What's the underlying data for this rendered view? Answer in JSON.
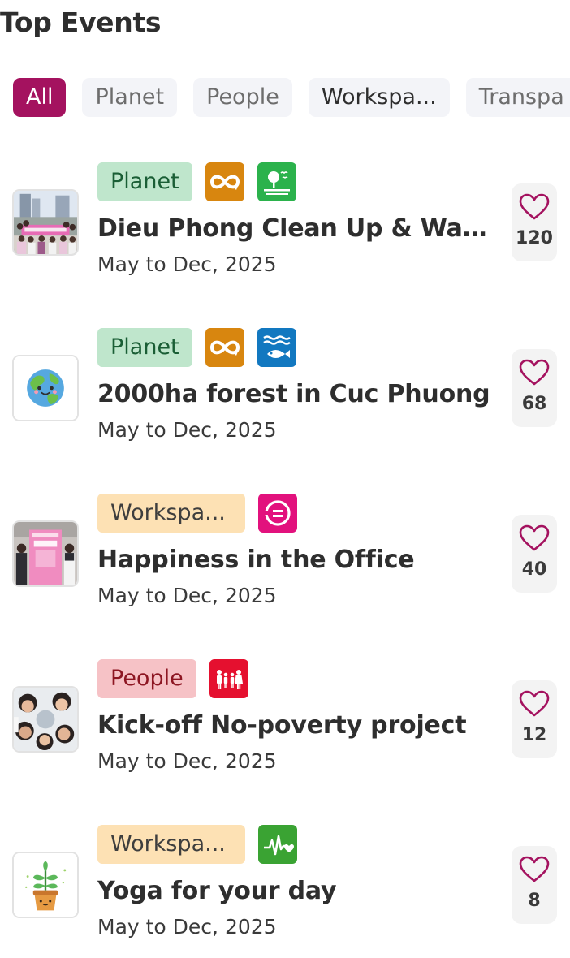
{
  "header": {
    "title": "Top Events"
  },
  "filters": [
    {
      "label": "All",
      "active": true
    },
    {
      "label": "Planet",
      "active": false
    },
    {
      "label": "People",
      "active": false
    },
    {
      "label": "Workspa...",
      "active": false
    },
    {
      "label": "Transpa",
      "active": false
    }
  ],
  "events": [
    {
      "category": "Planet",
      "sdg_icons": [
        "sdg-12-responsible-consumption-icon",
        "sdg-15-life-on-land-icon"
      ],
      "title": "Dieu Phong Clean Up & Wastin...",
      "date": "May to Dec, 2025",
      "likes": "120",
      "thumbnail": "group-photo-outdoor-banner"
    },
    {
      "category": "Planet",
      "sdg_icons": [
        "sdg-12-responsible-consumption-icon",
        "sdg-14-life-below-water-icon"
      ],
      "title": "2000ha forest in Cuc Phuong",
      "date": "May to Dec, 2025",
      "likes": "68",
      "thumbnail": "smiling-earth-icon"
    },
    {
      "category": "Workspa...",
      "sdg_icons": [
        "sdg-10-reduced-inequalities-icon"
      ],
      "title": "Happiness in the Office",
      "date": "May to Dec, 2025",
      "likes": "40",
      "thumbnail": "office-join-us-banner-photo"
    },
    {
      "category": "People",
      "sdg_icons": [
        "sdg-1-no-poverty-icon"
      ],
      "title": "Kick-off No-poverty project",
      "date": "May to Dec, 2025",
      "likes": "12",
      "thumbnail": "children-circle-photo"
    },
    {
      "category": "Workspa...",
      "sdg_icons": [
        "sdg-3-good-health-icon"
      ],
      "title": "Yoga for your day",
      "date": "May to Dec, 2025",
      "likes": "8",
      "thumbnail": "potted-plant-icon"
    }
  ],
  "colors": {
    "accent": "#a4125f",
    "planet_tag_bg": "#bfe6cc",
    "workspace_tag_bg": "#fde1b4",
    "people_tag_bg": "#f6c2c6",
    "sdg1": "#e5243b",
    "sdg3": "#4c9f38",
    "sdg10": "#dd1367",
    "sdg12": "#bf8b2e",
    "sdg14": "#0a97d9",
    "sdg15": "#56c02b"
  }
}
